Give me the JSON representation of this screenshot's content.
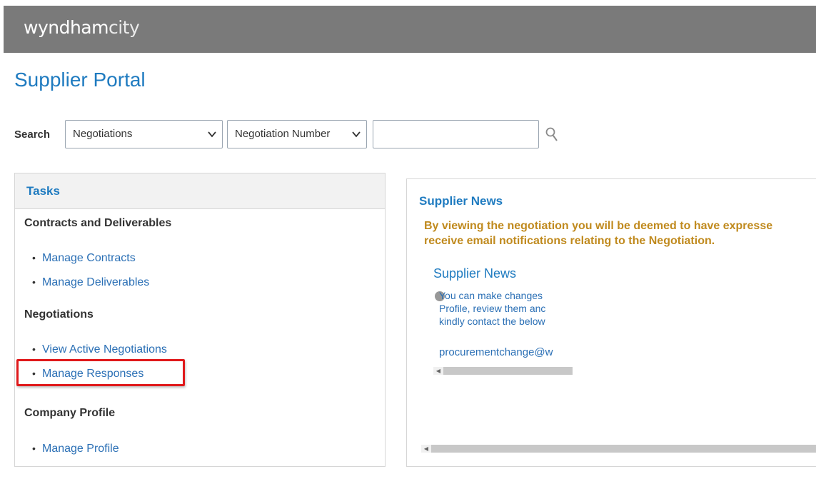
{
  "header": {
    "brand_bold": "wyndham",
    "brand_light": "city",
    "background_color": "#7a7a7a"
  },
  "page": {
    "title": "Supplier Portal"
  },
  "search": {
    "label": "Search",
    "category_value": "Negotiations",
    "field_value": "Negotiation Number",
    "input_value": "",
    "icon": "search-icon"
  },
  "tasks": {
    "header": "Tasks",
    "sections": [
      {
        "title": "Contracts and Deliverables",
        "links": [
          "Manage Contracts",
          "Manage Deliverables"
        ]
      },
      {
        "title": "Negotiations",
        "links": [
          "View Active Negotiations",
          "Manage Responses"
        ]
      },
      {
        "title": "Company Profile",
        "links": [
          "Manage Profile"
        ]
      }
    ],
    "highlight_color": "#e0191b"
  },
  "news": {
    "title": "Supplier News",
    "notice_line1": "By viewing the negotiation you will be deemed to have expresse",
    "notice_line2": "receive email notifications relating to the Negotiation.",
    "inner_title": "Supplier News",
    "inner_line1": "You can make changes",
    "inner_line2": "Profile, review them anc",
    "inner_line3": "kindly contact the below",
    "inner_email": "procurementchange@w"
  },
  "colors": {
    "accent": "#1f7bc0",
    "link": "#2a6fb5",
    "notice": "#c08a1e"
  }
}
